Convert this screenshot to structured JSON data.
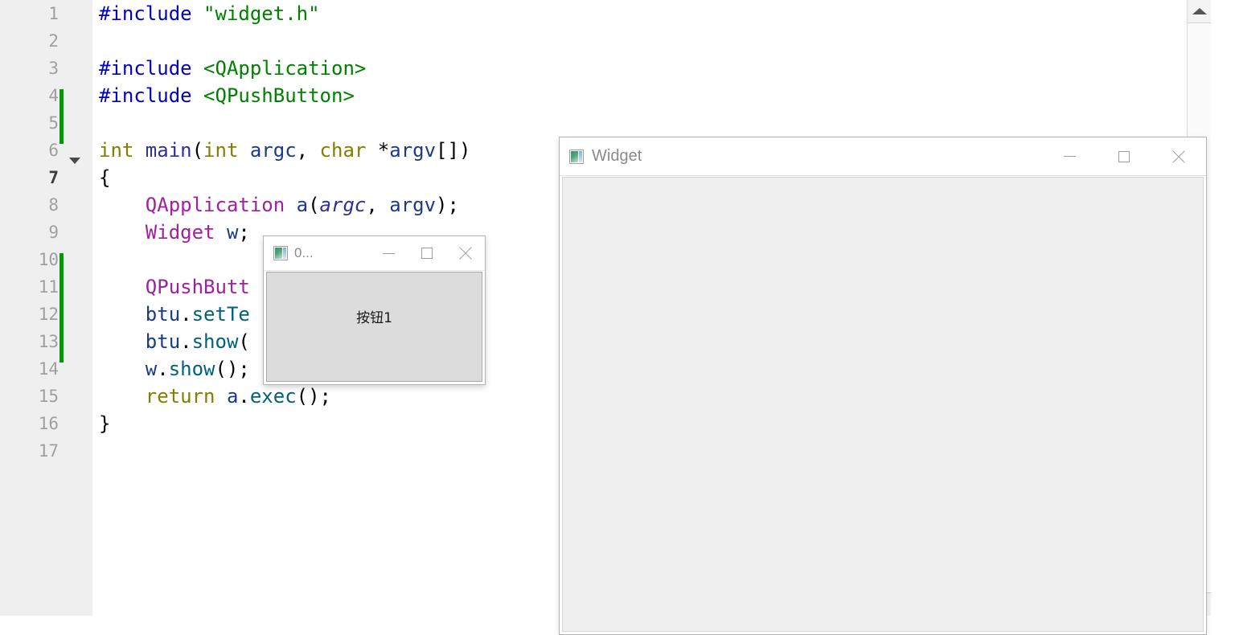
{
  "editor": {
    "gutter": {
      "line_numbers": [
        "1",
        "2",
        "3",
        "4",
        "5",
        "6",
        "7",
        "8",
        "9",
        "10",
        "11",
        "12",
        "13",
        "14",
        "15",
        "16",
        "17"
      ],
      "current_line": "7",
      "fold_marker_line": "6",
      "change_marker_color": "#009900",
      "change_ranges": [
        [
          4,
          5
        ],
        [
          10,
          13
        ]
      ]
    },
    "lines": [
      {
        "n": "1",
        "tokens": [
          {
            "t": "#include ",
            "c": "pre"
          },
          {
            "t": "\"widget.h\"",
            "c": "str"
          }
        ]
      },
      {
        "n": "2",
        "tokens": []
      },
      {
        "n": "3",
        "tokens": [
          {
            "t": "#include ",
            "c": "pre"
          },
          {
            "t": "<QApplication>",
            "c": "str"
          }
        ]
      },
      {
        "n": "4",
        "tokens": [
          {
            "t": "#include ",
            "c": "pre"
          },
          {
            "t": "<QPushButton>",
            "c": "str"
          }
        ]
      },
      {
        "n": "5",
        "tokens": []
      },
      {
        "n": "6",
        "tokens": [
          {
            "t": "int ",
            "c": "kw"
          },
          {
            "t": "main",
            "c": "fnmain"
          },
          {
            "t": "(",
            "c": "plain"
          },
          {
            "t": "int ",
            "c": "kw"
          },
          {
            "t": "argc",
            "c": "var"
          },
          {
            "t": ", ",
            "c": "plain"
          },
          {
            "t": "char ",
            "c": "kw"
          },
          {
            "t": "*",
            "c": "plain"
          },
          {
            "t": "argv",
            "c": "var"
          },
          {
            "t": "[])",
            "c": "plain"
          }
        ]
      },
      {
        "n": "7",
        "tokens": [
          {
            "t": "{",
            "c": "plain"
          }
        ]
      },
      {
        "n": "8",
        "tokens": [
          {
            "t": "    ",
            "c": "plain"
          },
          {
            "t": "QApplication",
            "c": "type"
          },
          {
            "t": " ",
            "c": "plain"
          },
          {
            "t": "a",
            "c": "var"
          },
          {
            "t": "(",
            "c": "plain"
          },
          {
            "t": "argc",
            "c": "param"
          },
          {
            "t": ", ",
            "c": "plain"
          },
          {
            "t": "argv",
            "c": "var"
          },
          {
            "t": ");",
            "c": "plain"
          }
        ]
      },
      {
        "n": "9",
        "tokens": [
          {
            "t": "    ",
            "c": "plain"
          },
          {
            "t": "Widget",
            "c": "type"
          },
          {
            "t": " ",
            "c": "plain"
          },
          {
            "t": "w",
            "c": "var"
          },
          {
            "t": ";",
            "c": "plain"
          }
        ]
      },
      {
        "n": "10",
        "tokens": []
      },
      {
        "n": "11",
        "tokens": [
          {
            "t": "    ",
            "c": "plain"
          },
          {
            "t": "QPushButt",
            "c": "type"
          }
        ]
      },
      {
        "n": "12",
        "tokens": [
          {
            "t": "    ",
            "c": "plain"
          },
          {
            "t": "btu",
            "c": "var"
          },
          {
            "t": ".",
            "c": "plain"
          },
          {
            "t": "setTe",
            "c": "fn"
          }
        ]
      },
      {
        "n": "13",
        "tokens": [
          {
            "t": "    ",
            "c": "plain"
          },
          {
            "t": "btu",
            "c": "var"
          },
          {
            "t": ".",
            "c": "plain"
          },
          {
            "t": "show",
            "c": "fn"
          },
          {
            "t": "(",
            "c": "plain"
          }
        ]
      },
      {
        "n": "14",
        "tokens": [
          {
            "t": "    ",
            "c": "plain"
          },
          {
            "t": "w",
            "c": "var"
          },
          {
            "t": ".",
            "c": "plain"
          },
          {
            "t": "show",
            "c": "fn"
          },
          {
            "t": "();",
            "c": "plain"
          }
        ]
      },
      {
        "n": "15",
        "tokens": [
          {
            "t": "    ",
            "c": "plain"
          },
          {
            "t": "return ",
            "c": "kw"
          },
          {
            "t": "a",
            "c": "var"
          },
          {
            "t": ".",
            "c": "plain"
          },
          {
            "t": "exec",
            "c": "fn"
          },
          {
            "t": "();",
            "c": "plain"
          }
        ]
      },
      {
        "n": "16",
        "tokens": [
          {
            "t": "}",
            "c": "plain"
          }
        ]
      },
      {
        "n": "17",
        "tokens": []
      }
    ]
  },
  "scrollbar": {
    "up_arrow_icon": "triangle-up-icon",
    "down_arrow_icon": "triangle-down-icon"
  },
  "widget_window": {
    "title": "Widget",
    "icon": "qt-app-icon",
    "minimize_label": "minimize-icon",
    "maximize_label": "maximize-icon",
    "close_label": "close-icon"
  },
  "button_window": {
    "title": "0...",
    "icon": "qt-app-icon",
    "minimize_label": "minimize-icon",
    "maximize_label": "maximize-icon",
    "close_label": "close-icon",
    "push_button_label": "按钮1"
  },
  "colors": {
    "gutter_bg": "#efefef",
    "code_bg": "#ffffff",
    "change_marker": "#009900",
    "widget_body": "#efefef",
    "button_window_body": "#dcdcdc",
    "preprocessor": "#0000c0",
    "string": "#008000",
    "keyword": "#808000",
    "type": "#a020a0",
    "function": "#00627a"
  }
}
